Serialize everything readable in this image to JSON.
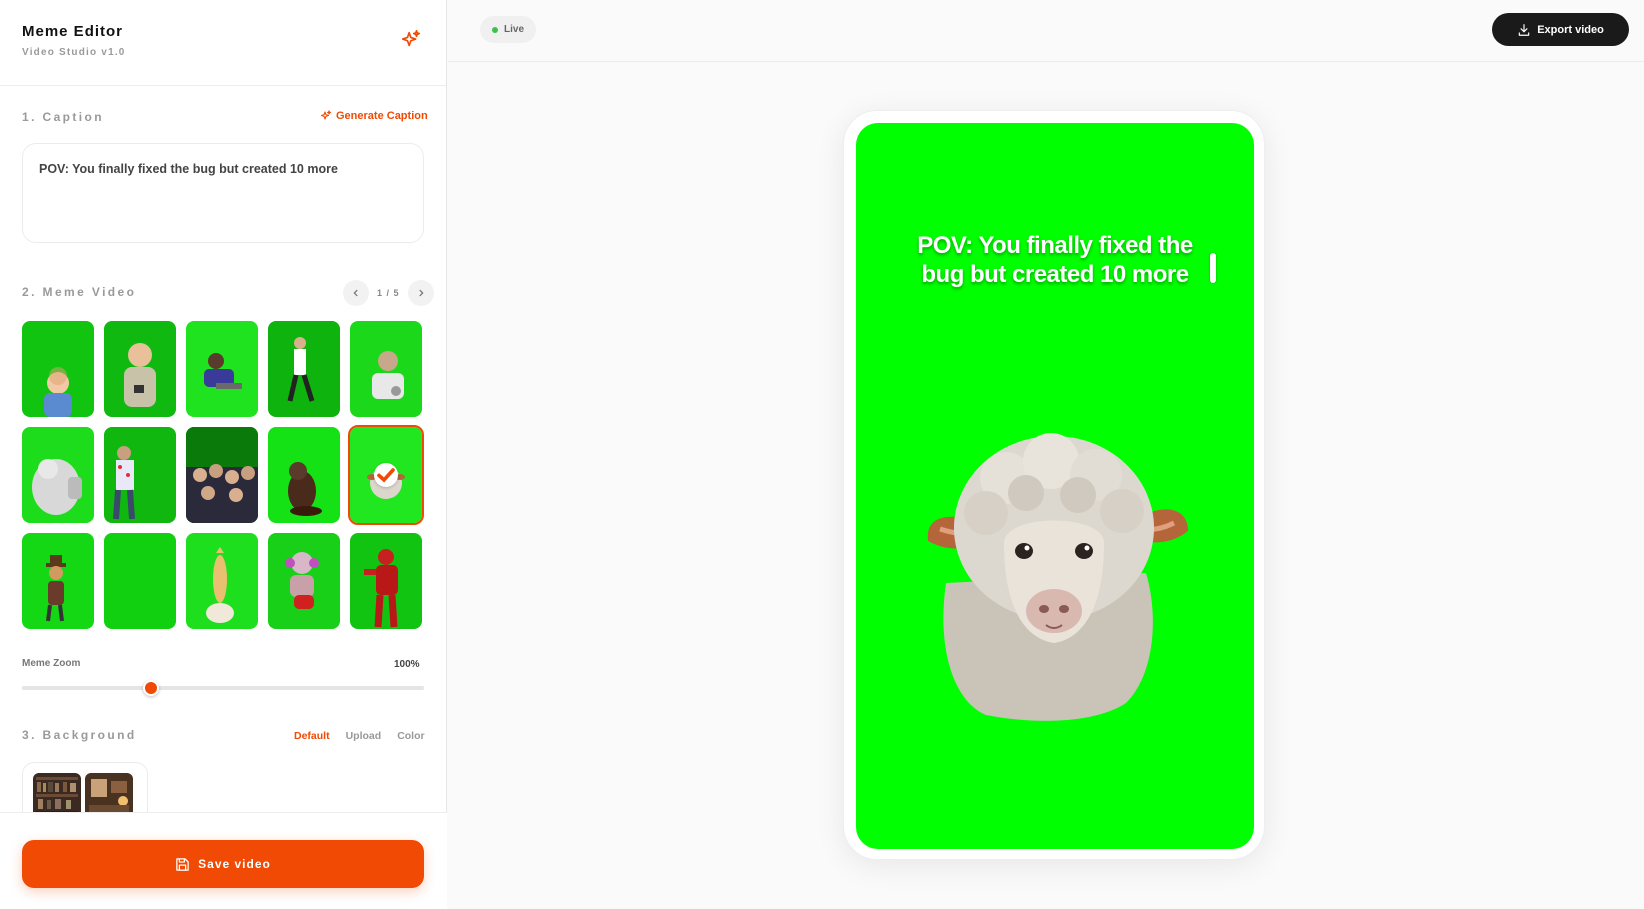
{
  "app": {
    "title": "Meme Editor",
    "subtitle": "Video Studio v1.0"
  },
  "caption_section": {
    "title": "1. Caption",
    "generate_label": "Generate Caption",
    "text": "POV: You finally fixed the bug but created 10 more"
  },
  "video_section": {
    "title": "2. Meme Video",
    "pager": "1 / 5",
    "selected_index": 9,
    "thumbnails": [
      {
        "name": "kid-shocked",
        "bg": "#10c410"
      },
      {
        "name": "boy-phone",
        "bg": "#10b910"
      },
      {
        "name": "man-sitting",
        "bg": "#1ee31e"
      },
      {
        "name": "man-dancing",
        "bg": "#0eb30e"
      },
      {
        "name": "old-man",
        "bg": "#1bd81b"
      },
      {
        "name": "cat-thumbsup",
        "bg": "#1cdc1c"
      },
      {
        "name": "man-pointing",
        "bg": "#0fb70f"
      },
      {
        "name": "crowd",
        "bg": "#0b8d0b"
      },
      {
        "name": "beaver",
        "bg": "#14e214"
      },
      {
        "name": "sheep",
        "bg": "#20e720"
      },
      {
        "name": "cat-cowboy",
        "bg": "#14d814"
      },
      {
        "name": "empty",
        "bg": "#10d010"
      },
      {
        "name": "cat-standing",
        "bg": "#1ddf1d"
      },
      {
        "name": "monkey-headphones",
        "bg": "#18d018"
      },
      {
        "name": "spiderman",
        "bg": "#12c412"
      }
    ],
    "zoom_label": "Meme Zoom",
    "zoom_value": "100%",
    "zoom_fraction": 0.32
  },
  "background_section": {
    "title": "3. Background",
    "tabs": [
      "Default",
      "Upload",
      "Color"
    ],
    "active_tab": "Default"
  },
  "footer": {
    "save_label": "Save video"
  },
  "topbar": {
    "live_label": "Live",
    "export_label": "Export video"
  },
  "preview": {
    "caption": "POV: You finally fixed the bug but created 10 more",
    "screen_color": "#00ff00"
  },
  "colors": {
    "accent": "#f04a05",
    "dark": "#1a1a1a"
  }
}
